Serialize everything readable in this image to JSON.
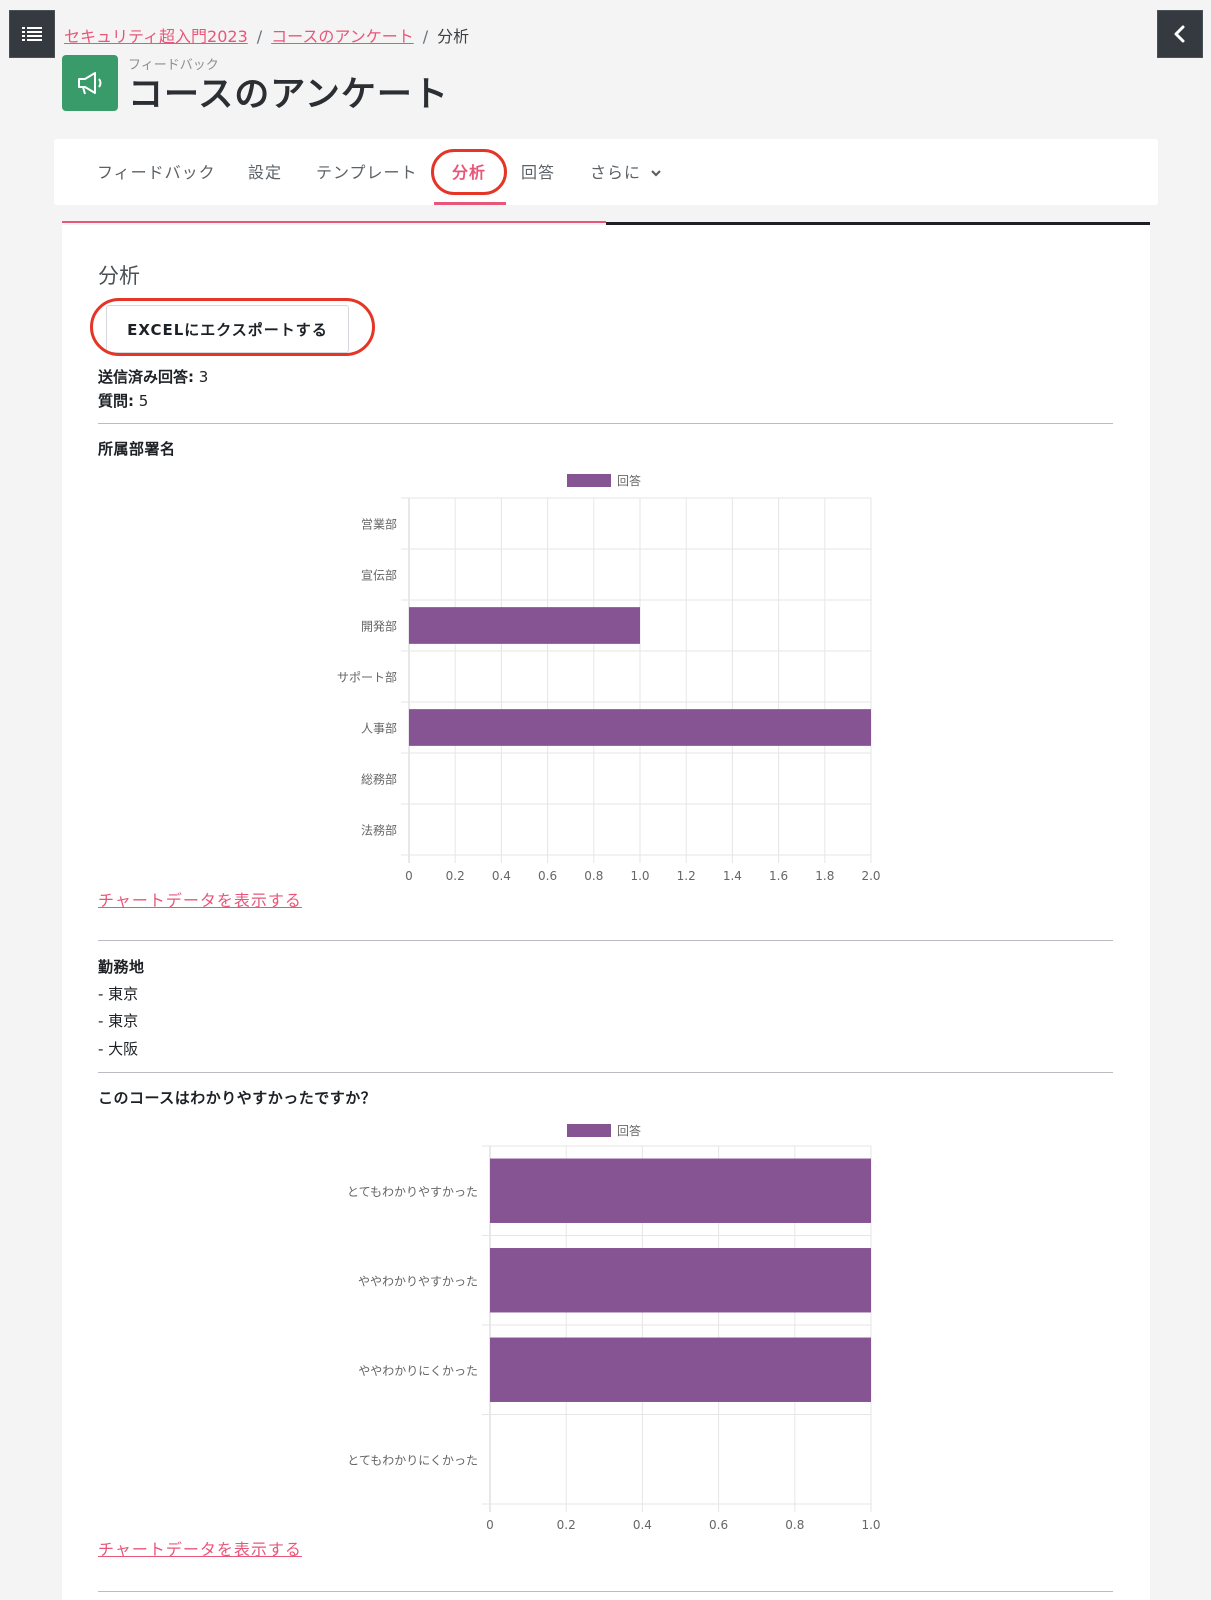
{
  "breadcrumb": {
    "course": "セキュリティ超入門2023",
    "activity": "コースのアンケート",
    "current": "分析",
    "separator": "/"
  },
  "header": {
    "pretitle": "フィードバック",
    "title": "コースのアンケート",
    "icon": "megaphone-icon",
    "icon_color": "#399b6a"
  },
  "nav": {
    "tabs": [
      {
        "label": "フィードバック",
        "active": false
      },
      {
        "label": "設定",
        "active": false
      },
      {
        "label": "テンプレート",
        "active": false
      },
      {
        "label": "分析",
        "active": true
      },
      {
        "label": "回答",
        "active": false
      },
      {
        "label": "さらに",
        "active": false
      }
    ]
  },
  "main": {
    "heading": "分析",
    "export_label": "EXCELにエクスポートする",
    "submitted_label": "送信済み回答:",
    "submitted_value": "3",
    "questions_label": "質問:",
    "questions_value": "5"
  },
  "questions": {
    "q1": {
      "title": "所属部署名",
      "show_data": "チャートデータを表示する"
    },
    "q2": {
      "title": "勤務地",
      "answers": [
        "- 東京",
        "- 東京",
        "- 大阪"
      ]
    },
    "q3": {
      "title": "このコースはわかりやすかったですか？",
      "show_data": "チャートデータを表示する"
    }
  },
  "colors": {
    "accent": "#e8577a",
    "bar": "#865393",
    "highlight_circle": "#e53526",
    "dark_button": "#343a40"
  },
  "chart_data": [
    {
      "type": "bar",
      "orientation": "horizontal",
      "legend": "回答",
      "legend_position": "top",
      "categories": [
        "営業部",
        "宣伝部",
        "開発部",
        "サポート部",
        "人事部",
        "総務部",
        "法務部"
      ],
      "series": [
        {
          "name": "回答",
          "values": [
            0,
            0,
            1,
            0,
            2,
            0,
            0
          ]
        }
      ],
      "xlim": [
        0,
        2
      ],
      "ticks": [
        "0",
        "0.2",
        "0.4",
        "0.6",
        "0.8",
        "1.0",
        "1.2",
        "1.4",
        "1.6",
        "1.8",
        "2.0"
      ],
      "grid": true
    },
    {
      "type": "bar",
      "orientation": "horizontal",
      "legend": "回答",
      "legend_position": "top",
      "categories": [
        "とてもわかりやすかった",
        "ややわかりやすかった",
        "ややわかりにくかった",
        "とてもわかりにくかった"
      ],
      "series": [
        {
          "name": "回答",
          "values": [
            1,
            1,
            1,
            0
          ]
        }
      ],
      "xlim": [
        0,
        1
      ],
      "ticks": [
        "0",
        "0.2",
        "0.4",
        "0.6",
        "0.8",
        "1.0"
      ],
      "grid": true
    }
  ]
}
